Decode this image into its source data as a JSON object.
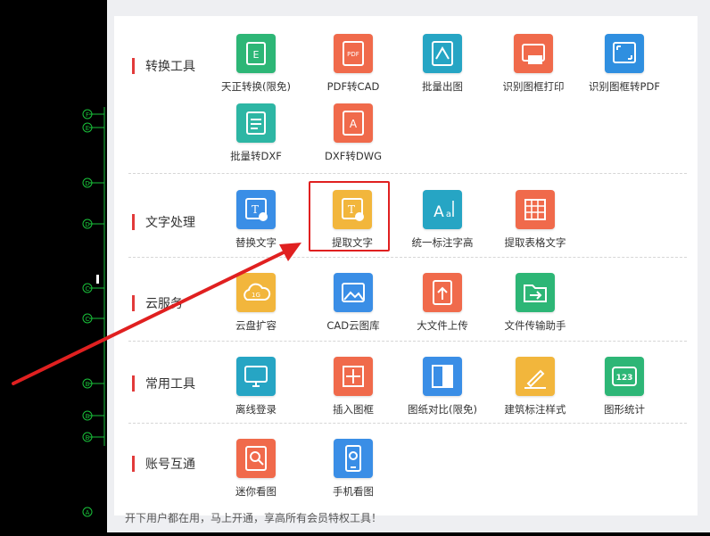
{
  "categories": [
    {
      "label": "转换工具"
    },
    {
      "label": "文字处理"
    },
    {
      "label": "云服务"
    },
    {
      "label": "常用工具"
    },
    {
      "label": "账号互通"
    }
  ],
  "tools": {
    "convert": [
      {
        "label": "天正转换(限免)",
        "icon": "tianzheng-convert-icon",
        "color": "#2db676"
      },
      {
        "label": "PDF转CAD",
        "icon": "pdf-to-cad-icon",
        "color": "#f06a4b"
      },
      {
        "label": "批量出图",
        "icon": "batch-plot-icon",
        "color": "#26a5c4"
      },
      {
        "label": "识别图框打印",
        "icon": "frame-print-icon",
        "color": "#f06a4b"
      },
      {
        "label": "识别图框转PDF",
        "icon": "frame-to-pdf-icon",
        "color": "#2f8fe0"
      },
      {
        "label": "批量转DXF",
        "icon": "batch-dxf-icon",
        "color": "#2db6a4"
      },
      {
        "label": "DXF转DWG",
        "icon": "dxf-to-dwg-icon",
        "color": "#f06a4b"
      }
    ],
    "text": [
      {
        "label": "替换文字",
        "icon": "replace-text-icon",
        "color": "#3a8ee6"
      },
      {
        "label": "提取文字",
        "icon": "extract-text-icon",
        "color": "#f2b63c"
      },
      {
        "label": "统一标注字高",
        "icon": "unify-text-height-icon",
        "color": "#26a5c4"
      },
      {
        "label": "提取表格文字",
        "icon": "extract-table-text-icon",
        "color": "#f06a4b"
      }
    ],
    "cloud": [
      {
        "label": "云盘扩容",
        "icon": "cloud-expand-icon",
        "color": "#f2b63c"
      },
      {
        "label": "CAD云图库",
        "icon": "cad-gallery-icon",
        "color": "#3a8ee6"
      },
      {
        "label": "大文件上传",
        "icon": "large-upload-icon",
        "color": "#f06a4b"
      },
      {
        "label": "文件传输助手",
        "icon": "file-transfer-icon",
        "color": "#2db676"
      }
    ],
    "common": [
      {
        "label": "离线登录",
        "icon": "offline-login-icon",
        "color": "#26a5c4"
      },
      {
        "label": "插入图框",
        "icon": "insert-frame-icon",
        "color": "#f06a4b"
      },
      {
        "label": "图纸对比(限免)",
        "icon": "drawing-compare-icon",
        "color": "#3a8ee6"
      },
      {
        "label": "建筑标注样式",
        "icon": "arch-dim-style-icon",
        "color": "#f2b63c"
      },
      {
        "label": "图形统计",
        "icon": "graphic-stats-icon",
        "color": "#2db676"
      }
    ],
    "account": [
      {
        "label": "迷你看图",
        "icon": "mini-viewer-icon",
        "color": "#f06a4b"
      },
      {
        "label": "手机看图",
        "icon": "mobile-viewer-icon",
        "color": "#3a8ee6"
      }
    ]
  },
  "bottom_note": "开下用户都在用，马上开通，享高所有会员特权工具！",
  "cad_axis_labels": [
    "F",
    "E",
    "D",
    "D",
    "C",
    "C",
    "B",
    "B",
    "B",
    "A"
  ]
}
